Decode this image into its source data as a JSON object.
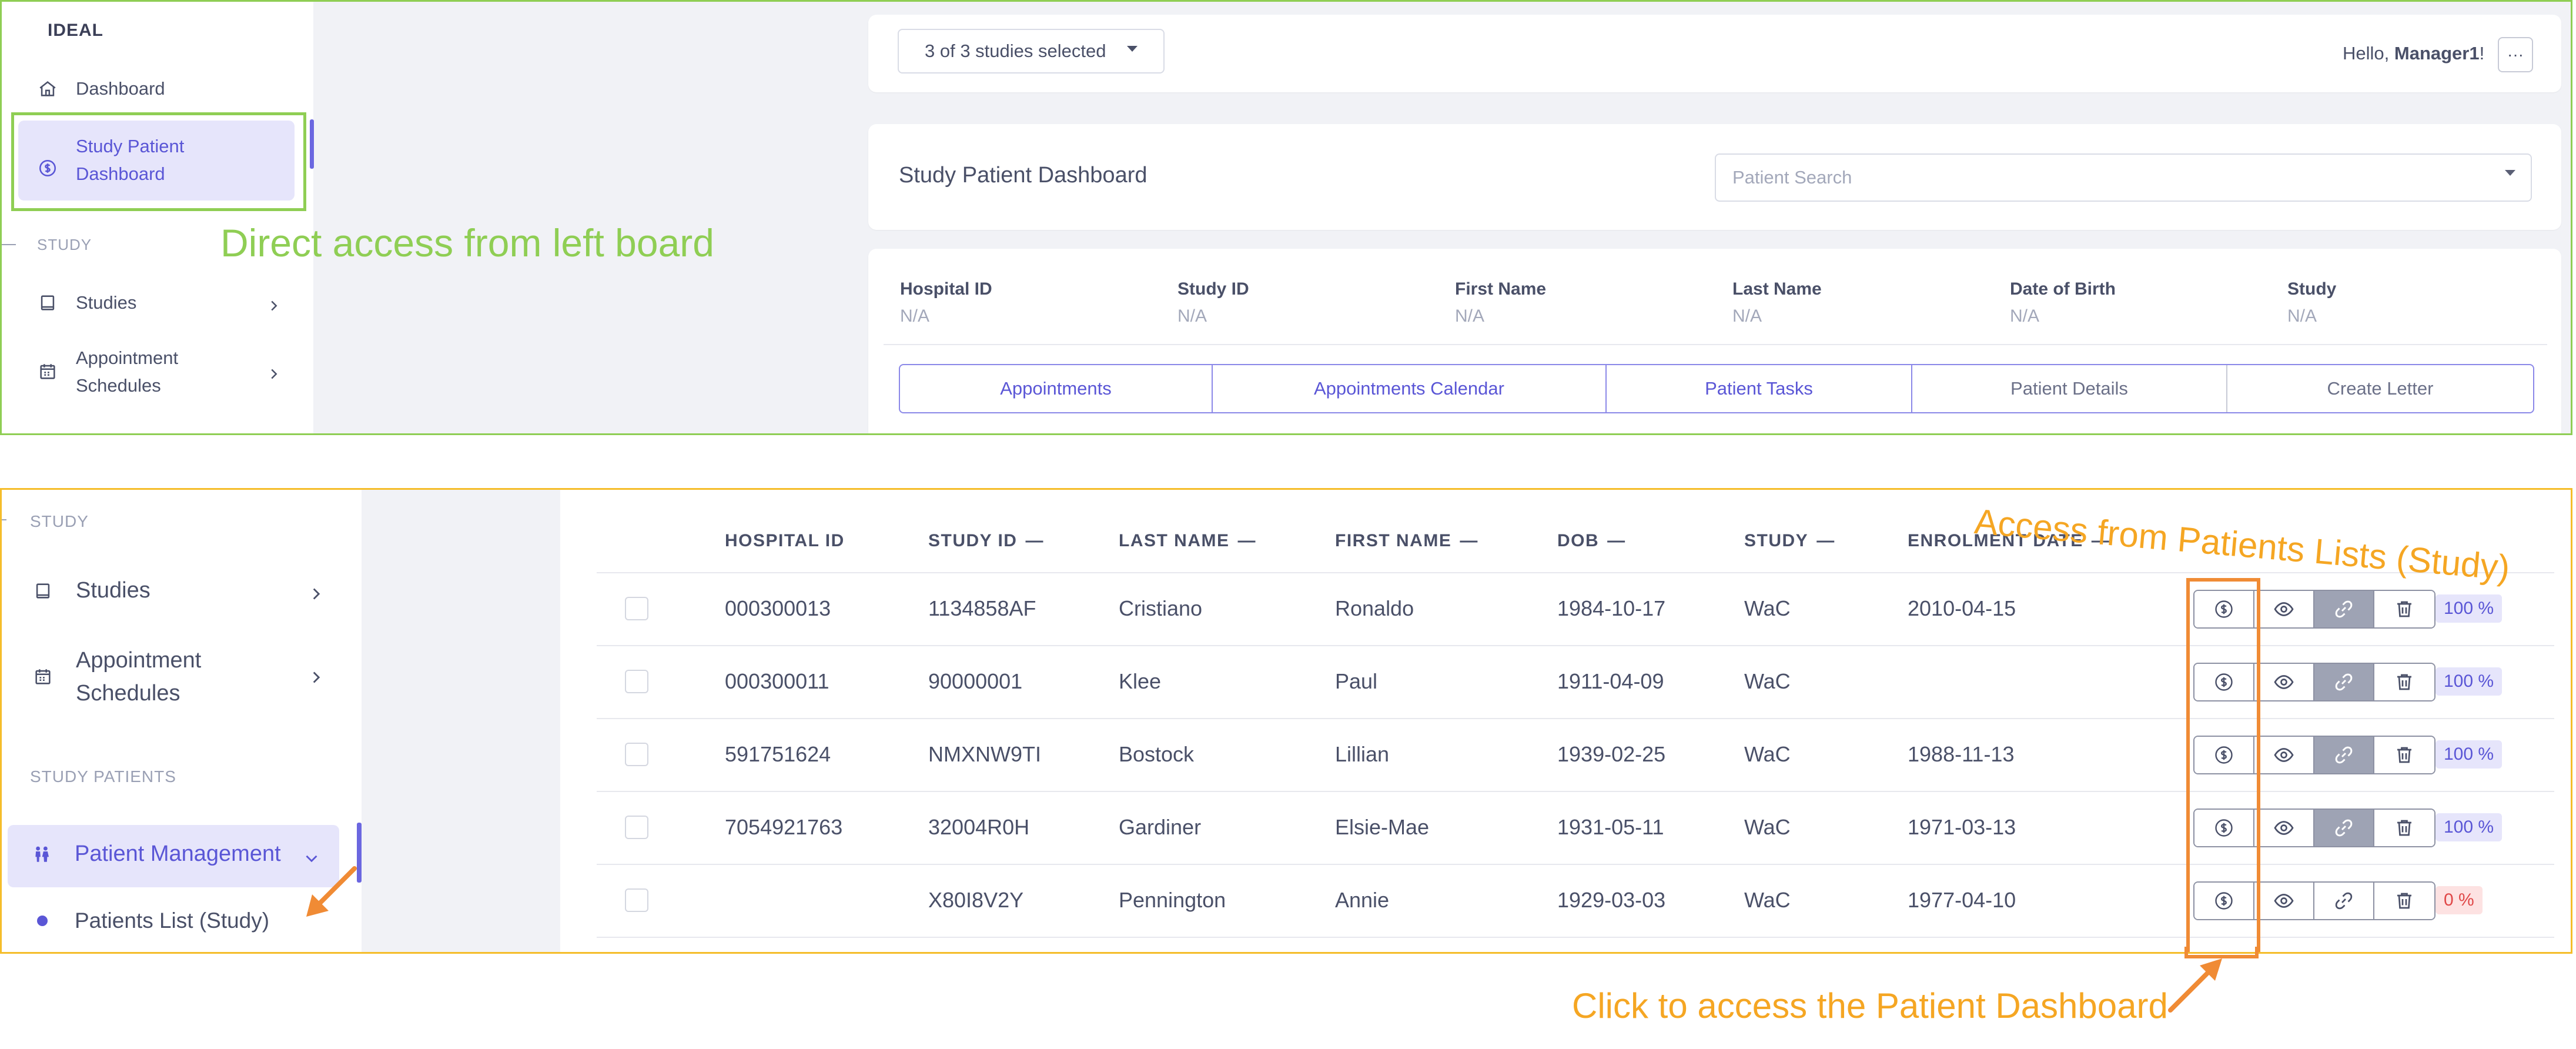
{
  "panel1": {
    "sidebar": {
      "brand": "IDEAL",
      "dashboard": "Dashboard",
      "study_patient_dashboard": "Study Patient Dashboard",
      "section_study": "STUDY",
      "studies": "Studies",
      "appointment_schedules": "Appointment Schedules"
    },
    "annotation": "Direct access from left board",
    "topbar": {
      "studies_selected": "3 of 3 studies selected",
      "hello_prefix": "Hello, ",
      "user": "Manager1",
      "hello_suffix": "!",
      "more": "···"
    },
    "title": "Study Patient Dashboard",
    "search_placeholder": "Patient Search",
    "info": [
      {
        "label": "Hospital ID",
        "value": "N/A"
      },
      {
        "label": "Study ID",
        "value": "N/A"
      },
      {
        "label": "First Name",
        "value": "N/A"
      },
      {
        "label": "Last Name",
        "value": "N/A"
      },
      {
        "label": "Date of Birth",
        "value": "N/A"
      },
      {
        "label": "Study",
        "value": "N/A"
      }
    ],
    "tabs": [
      "Appointments",
      "Appointments Calendar",
      "Patient Tasks",
      "Patient Details",
      "Create Letter"
    ]
  },
  "panel2": {
    "sidebar": {
      "section_study": "STUDY",
      "studies": "Studies",
      "appointment_schedules": "Appointment Schedules",
      "section_study_patients": "STUDY PATIENTS",
      "patient_management": "Patient Management",
      "patients_list": "Patients List (Study)"
    },
    "headers": [
      "HOSPITAL ID",
      "STUDY ID",
      "LAST NAME",
      "FIRST NAME",
      "DOB",
      "STUDY",
      "ENROLMENT DATE"
    ],
    "rows": [
      {
        "hospital_id": "000300013",
        "study_id": "1134858AF",
        "last_name": "Cristiano",
        "first_name": "Ronaldo",
        "dob": "1984-10-17",
        "study": "WaC",
        "enrolment_date": "2010-04-15",
        "percent": "100 %",
        "percent_value": 100
      },
      {
        "hospital_id": "000300011",
        "study_id": "90000001",
        "last_name": "Klee",
        "first_name": "Paul",
        "dob": "1911-04-09",
        "study": "WaC",
        "enrolment_date": "",
        "percent": "100 %",
        "percent_value": 100
      },
      {
        "hospital_id": "591751624",
        "study_id": "NMXNW9TI",
        "last_name": "Bostock",
        "first_name": "Lillian",
        "dob": "1939-02-25",
        "study": "WaC",
        "enrolment_date": "1988-11-13",
        "percent": "100 %",
        "percent_value": 100
      },
      {
        "hospital_id": "7054921763",
        "study_id": "32004R0H",
        "last_name": "Gardiner",
        "first_name": "Elsie-Mae",
        "dob": "1931-05-11",
        "study": "WaC",
        "enrolment_date": "1971-03-13",
        "percent": "100 %",
        "percent_value": 100
      },
      {
        "hospital_id": "",
        "study_id": "X80I8V2Y",
        "last_name": "Pennington",
        "first_name": "Annie",
        "dob": "1929-03-03",
        "study": "WaC",
        "enrolment_date": "1977-04-10",
        "percent": "0 %",
        "percent_value": 0
      }
    ],
    "annotation_top": "Access from Patients Lists (Study)",
    "annotation_bottom": "Click to access the Patient Dashboard"
  },
  "colors": {
    "green": "#8fce54",
    "orange_border": "#f5bd2a",
    "orange_text": "#f5a623",
    "orange_arrow": "#f08b35",
    "accent": "#5a56d6",
    "pct_full_bg": "#e6e5fb",
    "pct_zero_bg": "#fde2e2",
    "pct_zero_text": "#e04848"
  }
}
